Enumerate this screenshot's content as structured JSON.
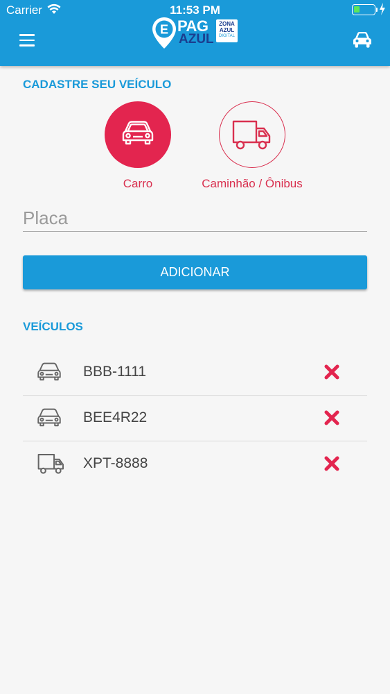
{
  "status_bar": {
    "carrier": "Carrier",
    "time": "11:53 PM",
    "battery_level": 0.3
  },
  "header": {
    "logo": {
      "pag": "PAG",
      "azul": "AZUL",
      "badge_line1": "ZONA",
      "badge_line2": "AZUL",
      "badge_line3": "DIGITAL",
      "pin_letter": "E"
    }
  },
  "register": {
    "title": "CADASTRE SEU VEÍCULO",
    "types": [
      {
        "label": "Carro",
        "icon": "car-icon",
        "selected": true
      },
      {
        "label": "Caminhão / Ônibus",
        "icon": "truck-icon",
        "selected": false
      }
    ],
    "plate_placeholder": "Placa",
    "plate_value": "",
    "add_label": "ADICIONAR"
  },
  "vehicles": {
    "title": "VEÍCULOS",
    "items": [
      {
        "plate": "BBB-1111",
        "icon": "car-icon"
      },
      {
        "plate": "BEE4R22",
        "icon": "car-icon"
      },
      {
        "plate": "XPT-8888",
        "icon": "truck-icon"
      }
    ]
  },
  "colors": {
    "primary": "#1a9ad9",
    "accent": "#e3254f",
    "logo_dark": "#1b3e8f"
  }
}
